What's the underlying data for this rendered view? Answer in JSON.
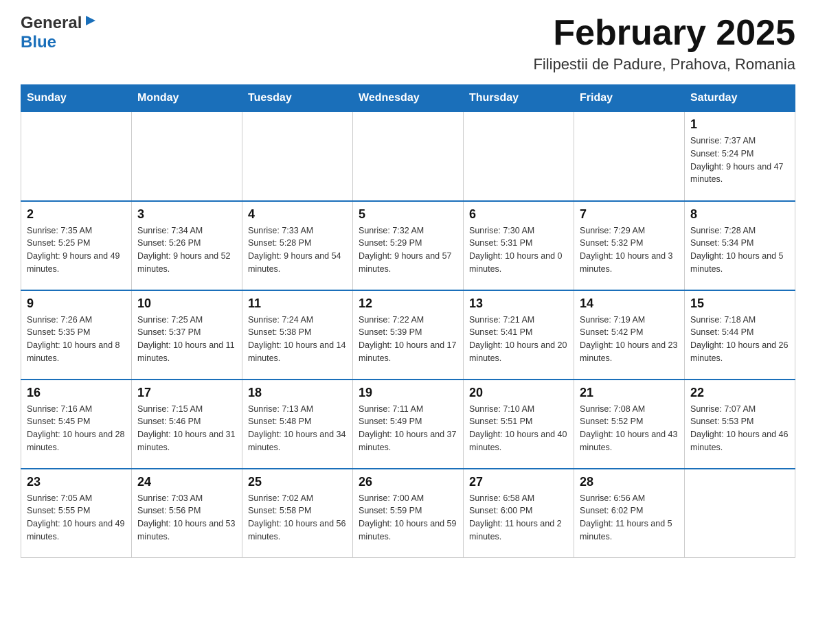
{
  "header": {
    "logo": {
      "general": "General",
      "blue": "Blue",
      "tagline": ""
    },
    "title": "February 2025",
    "subtitle": "Filipestii de Padure, Prahova, Romania"
  },
  "calendar": {
    "days_of_week": [
      "Sunday",
      "Monday",
      "Tuesday",
      "Wednesday",
      "Thursday",
      "Friday",
      "Saturday"
    ],
    "weeks": [
      {
        "cells": [
          {
            "day": "",
            "info": ""
          },
          {
            "day": "",
            "info": ""
          },
          {
            "day": "",
            "info": ""
          },
          {
            "day": "",
            "info": ""
          },
          {
            "day": "",
            "info": ""
          },
          {
            "day": "",
            "info": ""
          },
          {
            "day": "1",
            "info": "Sunrise: 7:37 AM\nSunset: 5:24 PM\nDaylight: 9 hours and 47 minutes."
          }
        ]
      },
      {
        "cells": [
          {
            "day": "2",
            "info": "Sunrise: 7:35 AM\nSunset: 5:25 PM\nDaylight: 9 hours and 49 minutes."
          },
          {
            "day": "3",
            "info": "Sunrise: 7:34 AM\nSunset: 5:26 PM\nDaylight: 9 hours and 52 minutes."
          },
          {
            "day": "4",
            "info": "Sunrise: 7:33 AM\nSunset: 5:28 PM\nDaylight: 9 hours and 54 minutes."
          },
          {
            "day": "5",
            "info": "Sunrise: 7:32 AM\nSunset: 5:29 PM\nDaylight: 9 hours and 57 minutes."
          },
          {
            "day": "6",
            "info": "Sunrise: 7:30 AM\nSunset: 5:31 PM\nDaylight: 10 hours and 0 minutes."
          },
          {
            "day": "7",
            "info": "Sunrise: 7:29 AM\nSunset: 5:32 PM\nDaylight: 10 hours and 3 minutes."
          },
          {
            "day": "8",
            "info": "Sunrise: 7:28 AM\nSunset: 5:34 PM\nDaylight: 10 hours and 5 minutes."
          }
        ]
      },
      {
        "cells": [
          {
            "day": "9",
            "info": "Sunrise: 7:26 AM\nSunset: 5:35 PM\nDaylight: 10 hours and 8 minutes."
          },
          {
            "day": "10",
            "info": "Sunrise: 7:25 AM\nSunset: 5:37 PM\nDaylight: 10 hours and 11 minutes."
          },
          {
            "day": "11",
            "info": "Sunrise: 7:24 AM\nSunset: 5:38 PM\nDaylight: 10 hours and 14 minutes."
          },
          {
            "day": "12",
            "info": "Sunrise: 7:22 AM\nSunset: 5:39 PM\nDaylight: 10 hours and 17 minutes."
          },
          {
            "day": "13",
            "info": "Sunrise: 7:21 AM\nSunset: 5:41 PM\nDaylight: 10 hours and 20 minutes."
          },
          {
            "day": "14",
            "info": "Sunrise: 7:19 AM\nSunset: 5:42 PM\nDaylight: 10 hours and 23 minutes."
          },
          {
            "day": "15",
            "info": "Sunrise: 7:18 AM\nSunset: 5:44 PM\nDaylight: 10 hours and 26 minutes."
          }
        ]
      },
      {
        "cells": [
          {
            "day": "16",
            "info": "Sunrise: 7:16 AM\nSunset: 5:45 PM\nDaylight: 10 hours and 28 minutes."
          },
          {
            "day": "17",
            "info": "Sunrise: 7:15 AM\nSunset: 5:46 PM\nDaylight: 10 hours and 31 minutes."
          },
          {
            "day": "18",
            "info": "Sunrise: 7:13 AM\nSunset: 5:48 PM\nDaylight: 10 hours and 34 minutes."
          },
          {
            "day": "19",
            "info": "Sunrise: 7:11 AM\nSunset: 5:49 PM\nDaylight: 10 hours and 37 minutes."
          },
          {
            "day": "20",
            "info": "Sunrise: 7:10 AM\nSunset: 5:51 PM\nDaylight: 10 hours and 40 minutes."
          },
          {
            "day": "21",
            "info": "Sunrise: 7:08 AM\nSunset: 5:52 PM\nDaylight: 10 hours and 43 minutes."
          },
          {
            "day": "22",
            "info": "Sunrise: 7:07 AM\nSunset: 5:53 PM\nDaylight: 10 hours and 46 minutes."
          }
        ]
      },
      {
        "cells": [
          {
            "day": "23",
            "info": "Sunrise: 7:05 AM\nSunset: 5:55 PM\nDaylight: 10 hours and 49 minutes."
          },
          {
            "day": "24",
            "info": "Sunrise: 7:03 AM\nSunset: 5:56 PM\nDaylight: 10 hours and 53 minutes."
          },
          {
            "day": "25",
            "info": "Sunrise: 7:02 AM\nSunset: 5:58 PM\nDaylight: 10 hours and 56 minutes."
          },
          {
            "day": "26",
            "info": "Sunrise: 7:00 AM\nSunset: 5:59 PM\nDaylight: 10 hours and 59 minutes."
          },
          {
            "day": "27",
            "info": "Sunrise: 6:58 AM\nSunset: 6:00 PM\nDaylight: 11 hours and 2 minutes."
          },
          {
            "day": "28",
            "info": "Sunrise: 6:56 AM\nSunset: 6:02 PM\nDaylight: 11 hours and 5 minutes."
          },
          {
            "day": "",
            "info": ""
          }
        ]
      }
    ]
  }
}
